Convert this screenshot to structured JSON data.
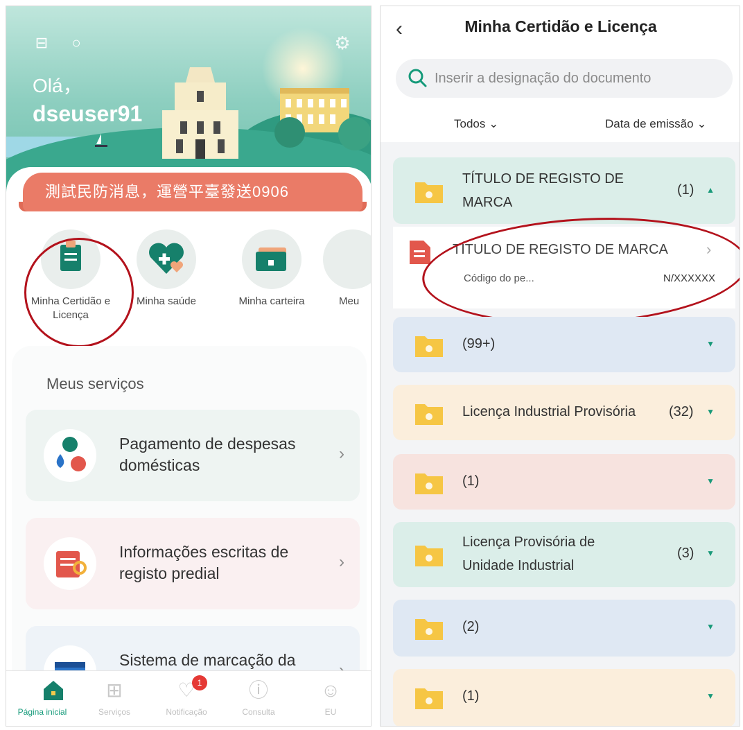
{
  "home": {
    "greeting": "Olá，",
    "username": "dseuser91",
    "banner_text": "測試民防消息，運營平臺發送0906",
    "quick_items": [
      {
        "label": "Minha Certidão e Licença",
        "icon": "certificate-icon"
      },
      {
        "label": "Minha saúde",
        "icon": "heart-plus-icon"
      },
      {
        "label": "Minha carteira",
        "icon": "wallet-card-icon"
      },
      {
        "label": "Meu",
        "icon": "more-icon"
      }
    ],
    "services_title": "Meus serviços",
    "services": [
      {
        "label": "Pagamento de despesas domésticas",
        "icon": "utilities-icon",
        "bg": "#eef4f2"
      },
      {
        "label": "Informações escritas de registo predial",
        "icon": "property-register-icon",
        "bg": "#faf0f1"
      },
      {
        "label": "Sistema de marcação da",
        "icon": "appointment-icon",
        "bg": "#eef3f8"
      }
    ],
    "tabs": [
      {
        "label": "Página inicial",
        "icon": "home-icon"
      },
      {
        "label": "Serviços",
        "icon": "grid-icon"
      },
      {
        "label": "Notificação",
        "icon": "bell-icon",
        "badge": "1"
      },
      {
        "label": "Consulta",
        "icon": "question-icon"
      },
      {
        "label": "EU",
        "icon": "user-icon"
      }
    ]
  },
  "docs": {
    "title": "Minha Certidão e Licença",
    "search_placeholder": "Inserir a designação do documento",
    "filter_all": "Todos",
    "filter_date": "Data de emissão",
    "groups": [
      {
        "name": "TÍTULO DE REGISTO DE MARCA",
        "count": "(1)",
        "bg": "#dbeee9",
        "expanded": true
      },
      {
        "name": "",
        "count": "(99+)",
        "bg": "#dfe8f3"
      },
      {
        "name": "Licença Industrial Provisória",
        "count": "(32)",
        "bg": "#fbeedc"
      },
      {
        "name": "",
        "count": "(1)",
        "bg": "#f7e3df"
      },
      {
        "name": "Licença Provisória de Unidade Industrial",
        "count": "(3)",
        "bg": "#dbeee9"
      },
      {
        "name": "",
        "count": "(2)",
        "bg": "#dfe8f3"
      },
      {
        "name": "",
        "count": "(1)",
        "bg": "#fbeedc"
      }
    ],
    "expanded_doc": {
      "name": "TÍTULO DE REGISTO DE MARCA",
      "code_label": "Código do pe...",
      "code_value": "N/XXXXXX"
    }
  },
  "colors": {
    "accent": "#159a7a",
    "highlight_ring": "#b3121c",
    "banner": "#ea7b67",
    "folder": "#f6c644"
  }
}
